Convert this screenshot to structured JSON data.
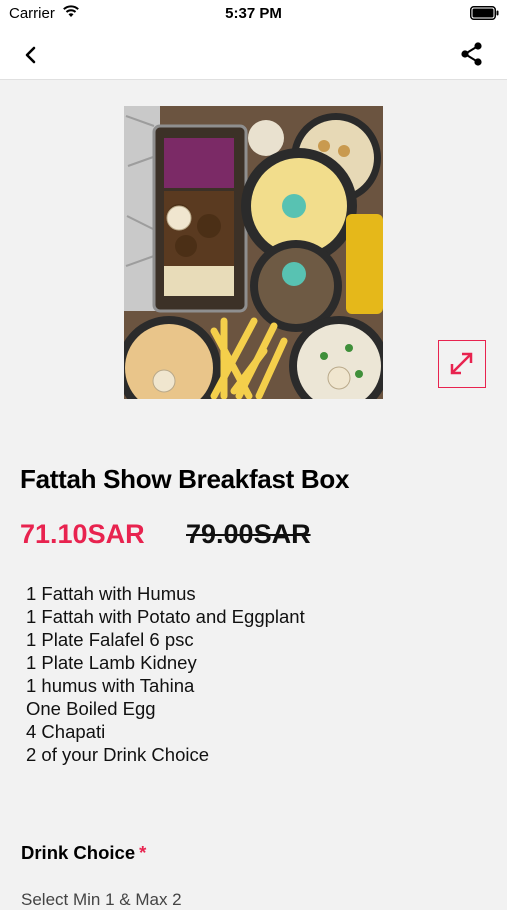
{
  "status": {
    "carrier": "Carrier",
    "time": "5:37 PM"
  },
  "nav": {
    "back_icon": "chevron-left-icon",
    "share_icon": "share-icon"
  },
  "product": {
    "name": "Fattah Show Breakfast Box",
    "price": "71.10SAR",
    "old_price": "79.00SAR",
    "image_alt": "breakfast box food photo",
    "expand_icon": "expand-arrows-icon",
    "items": [
      "1 Fattah with Humus",
      "1 Fattah with Potato and Eggplant",
      "1 Plate Falafel 6 psc",
      "1 Plate Lamb Kidney",
      "1 humus with Tahina",
      "One Boiled Egg",
      "4 Chapati",
      "2 of your Drink Choice"
    ]
  },
  "options": {
    "drink_title": "Drink Choice",
    "required_mark": "*",
    "select_note": "Select Min 1 & Max 2"
  },
  "colors": {
    "accent": "#e8234f",
    "background": "#f2f2f2"
  }
}
